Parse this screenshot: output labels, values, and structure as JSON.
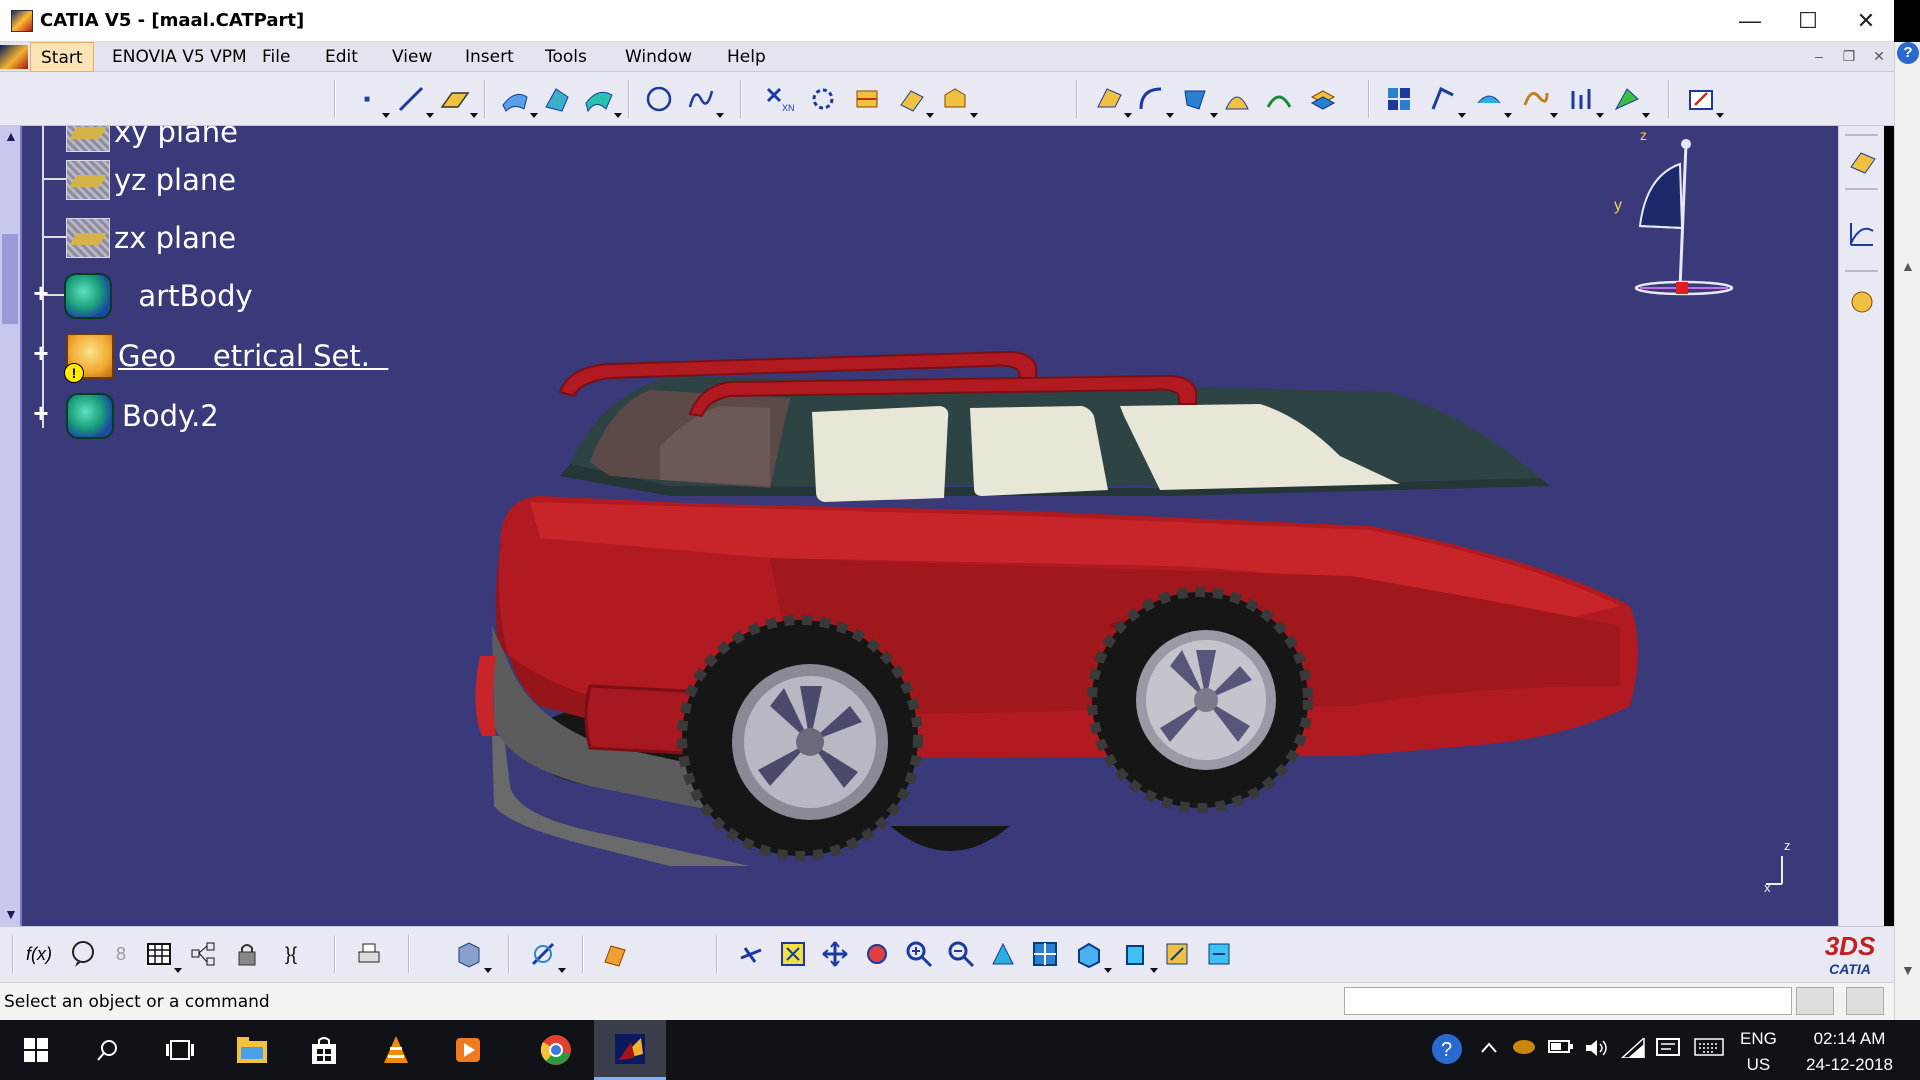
{
  "window": {
    "title": "CATIA V5 - [maal.CATPart]",
    "minimize_glyph": "—",
    "maximize_glyph": "☐",
    "close_glyph": "✕"
  },
  "menu": {
    "start": "Start",
    "enovia": "ENOVIA V5 VPM",
    "file": "File",
    "edit": "Edit",
    "view": "View",
    "insert": "Insert",
    "tools": "Tools",
    "window": "Window",
    "help": "Help",
    "mdi_minimize": "–",
    "mdi_restore": "❐",
    "mdi_close": "✕"
  },
  "tree": {
    "items": [
      {
        "label": "xy plane",
        "icon": "plane-icon"
      },
      {
        "label": "yz plane",
        "icon": "plane-icon"
      },
      {
        "label": "zx plane",
        "icon": "plane-icon"
      },
      {
        "label": "  artBody",
        "icon": "partbody-icon",
        "expander": "+"
      },
      {
        "label": "Geo    etrical Set.  ",
        "icon": "geometrical-set-icon",
        "expander": "+",
        "underlined": true
      },
      {
        "label": "Body.2",
        "icon": "body-icon",
        "expander": "+"
      }
    ]
  },
  "compass": {
    "z_label": "z",
    "y_label": "y"
  },
  "axis_small": {
    "z_label": "z",
    "x_label": "x"
  },
  "colors": {
    "viewport_bg": "#3a3a7a",
    "car_body": "#b01a20",
    "car_roof": "#2e4444",
    "window_glass": "#e8e6d6",
    "tree_text": "#ffffff"
  },
  "catia_logo": {
    "mark": "3DS",
    "text": "CATIA"
  },
  "status": {
    "message": "Select an object or a command",
    "command_input": ""
  },
  "taskbar": {
    "lang_top": "ENG",
    "lang_bottom": "US",
    "time": "02:14 AM",
    "date": "24-12-2018"
  }
}
